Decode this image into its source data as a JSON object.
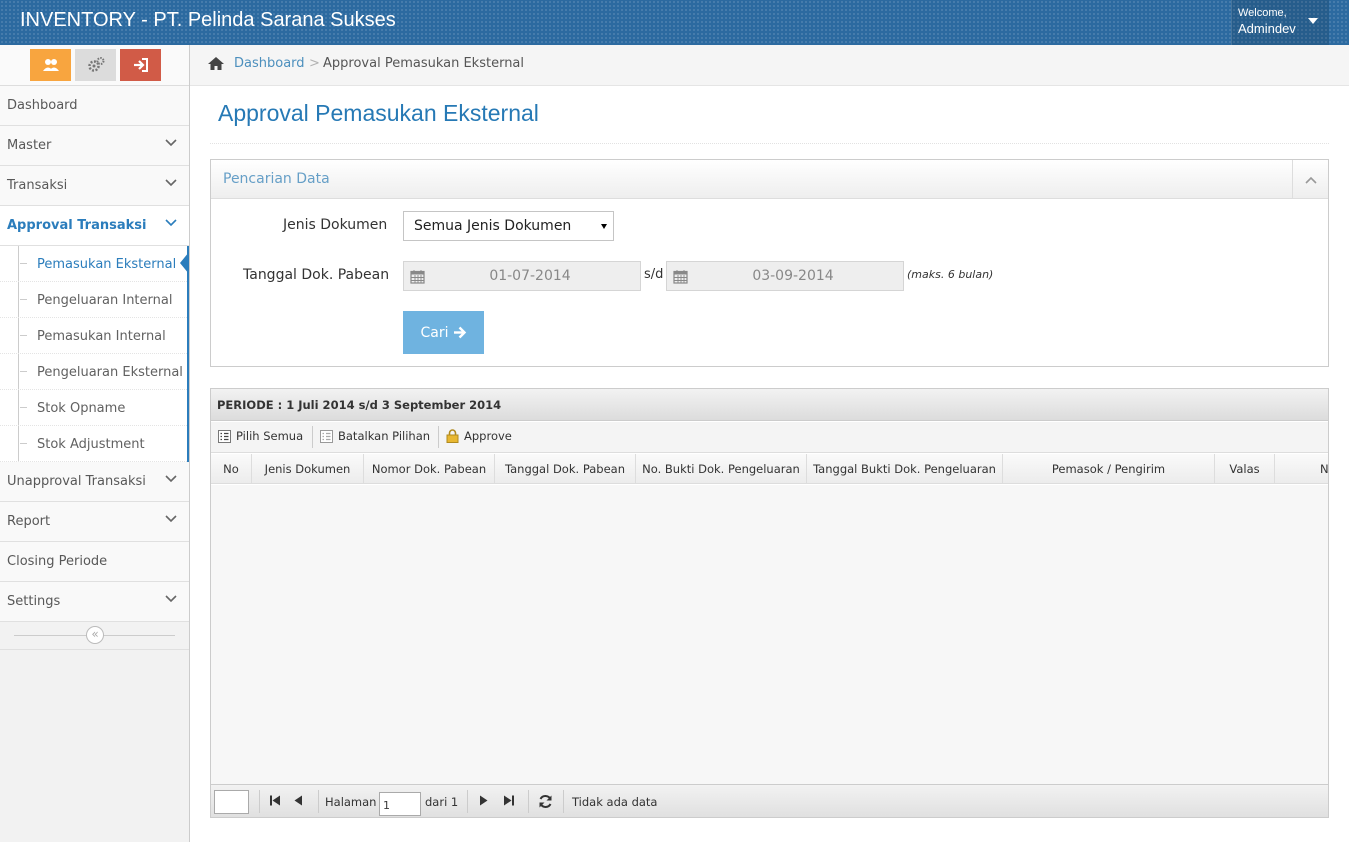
{
  "header": {
    "app_title": "INVENTORY - PT. Pelinda Sarana Sukses",
    "welcome": "Welcome,",
    "user": "Admindev"
  },
  "sidebar": {
    "items": [
      {
        "label": "Dashboard"
      },
      {
        "label": "Master"
      },
      {
        "label": "Transaksi"
      },
      {
        "label": "Approval Transaksi"
      },
      {
        "label": "Unapproval Transaksi"
      },
      {
        "label": "Report"
      },
      {
        "label": "Closing Periode"
      },
      {
        "label": "Settings"
      }
    ],
    "submenu": [
      {
        "label": "Pemasukan Eksternal"
      },
      {
        "label": "Pengeluaran Internal"
      },
      {
        "label": "Pemasukan Internal"
      },
      {
        "label": "Pengeluaran Eksternal"
      },
      {
        "label": "Stok Opname"
      },
      {
        "label": "Stok Adjustment"
      }
    ]
  },
  "breadcrumb": {
    "home": "Dashboard",
    "sep": ">",
    "current": "Approval Pemasukan Eksternal"
  },
  "page": {
    "title": "Approval Pemasukan Eksternal"
  },
  "search": {
    "title": "Pencarian Data",
    "jenis_label": "Jenis Dokumen",
    "jenis_value": "Semua Jenis Dokumen",
    "tanggal_label": "Tanggal Dok. Pabean",
    "date_from": "01-07-2014",
    "sd": "s/d",
    "date_to": "03-09-2014",
    "note": "(maks. 6 bulan)",
    "button": "Cari"
  },
  "grid": {
    "caption": "PERIODE : 1 Juli 2014 s/d 3 September 2014",
    "toolbar": {
      "select_all": "Pilih Semua",
      "deselect": "Batalkan Pilihan",
      "approve": "Approve"
    },
    "columns": [
      "No",
      "Jenis Dokumen",
      "Nomor Dok. Pabean",
      "Tanggal Dok. Pabean",
      "No. Bukti Dok. Pengeluaran",
      "Tanggal Bukti Dok. Pengeluaran",
      "Pemasok / Pengirim",
      "Valas",
      "Nila"
    ],
    "pager": {
      "halaman": "Halaman",
      "page": "1",
      "dari": "dari 1",
      "info": "Tidak ada data"
    }
  },
  "colors": {
    "brand": "#2c6aa0",
    "accent": "#2b7dbc",
    "search_button": "#6fb3e0",
    "shortcut_orange": "#f8a53f",
    "shortcut_gray": "#dcdcdc",
    "shortcut_red": "#d15b47"
  }
}
